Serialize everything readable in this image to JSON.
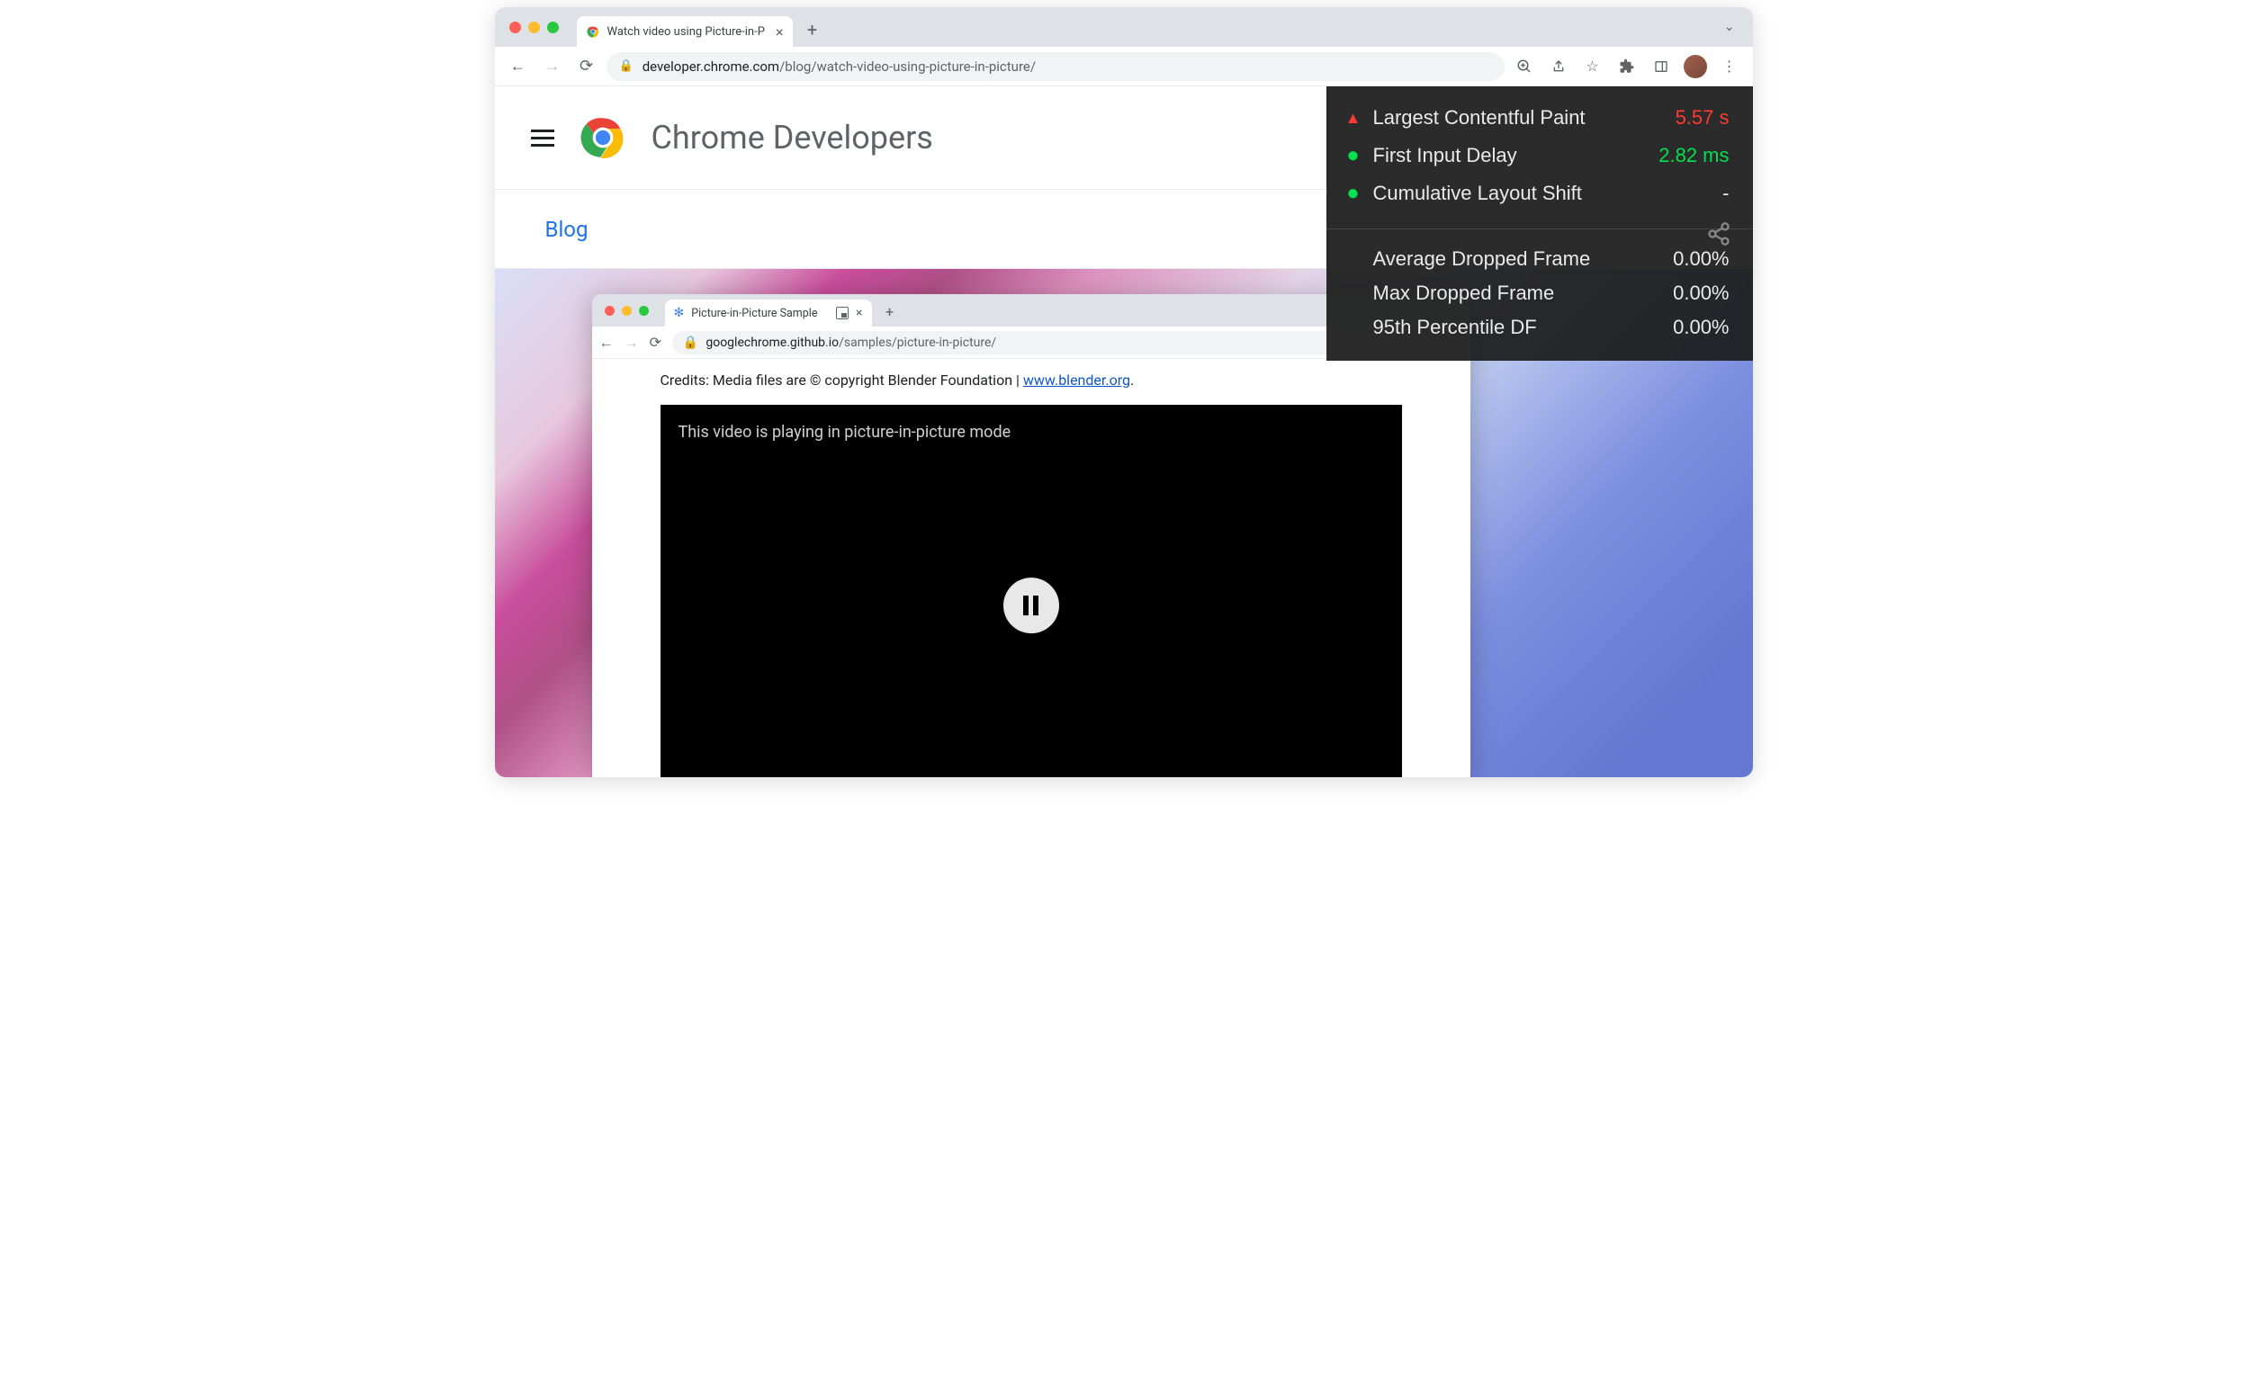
{
  "outer_browser": {
    "tab_title": "Watch video using Picture-in-P",
    "url_host": "developer.chrome.com",
    "url_path": "/blog/watch-video-using-picture-in-picture/"
  },
  "site": {
    "title": "Chrome Developers",
    "breadcrumb": "Blog"
  },
  "inner_browser": {
    "tab_title": "Picture-in-Picture Sample",
    "url_host": "googlechrome.github.io",
    "url_path": "/samples/picture-in-picture/",
    "credits_prefix": "Credits: Media files are © copyright Blender Foundation | ",
    "credits_link": "www.blender.org",
    "credits_suffix": ".",
    "video_message": "This video is playing in picture-in-picture mode"
  },
  "metrics": {
    "core": [
      {
        "indicator": "triangle",
        "label": "Largest Contentful Paint",
        "value": "5.57 s",
        "status": "bad"
      },
      {
        "indicator": "dot",
        "label": "First Input Delay",
        "value": "2.82 ms",
        "status": "good"
      },
      {
        "indicator": "dot",
        "label": "Cumulative Layout Shift",
        "value": "-",
        "status": "neutral"
      }
    ],
    "dropped_frames": [
      {
        "label": "Average Dropped Frame",
        "value": "0.00%"
      },
      {
        "label": "Max Dropped Frame",
        "value": "0.00%"
      },
      {
        "label": "95th Percentile DF",
        "value": "0.00%"
      }
    ]
  }
}
